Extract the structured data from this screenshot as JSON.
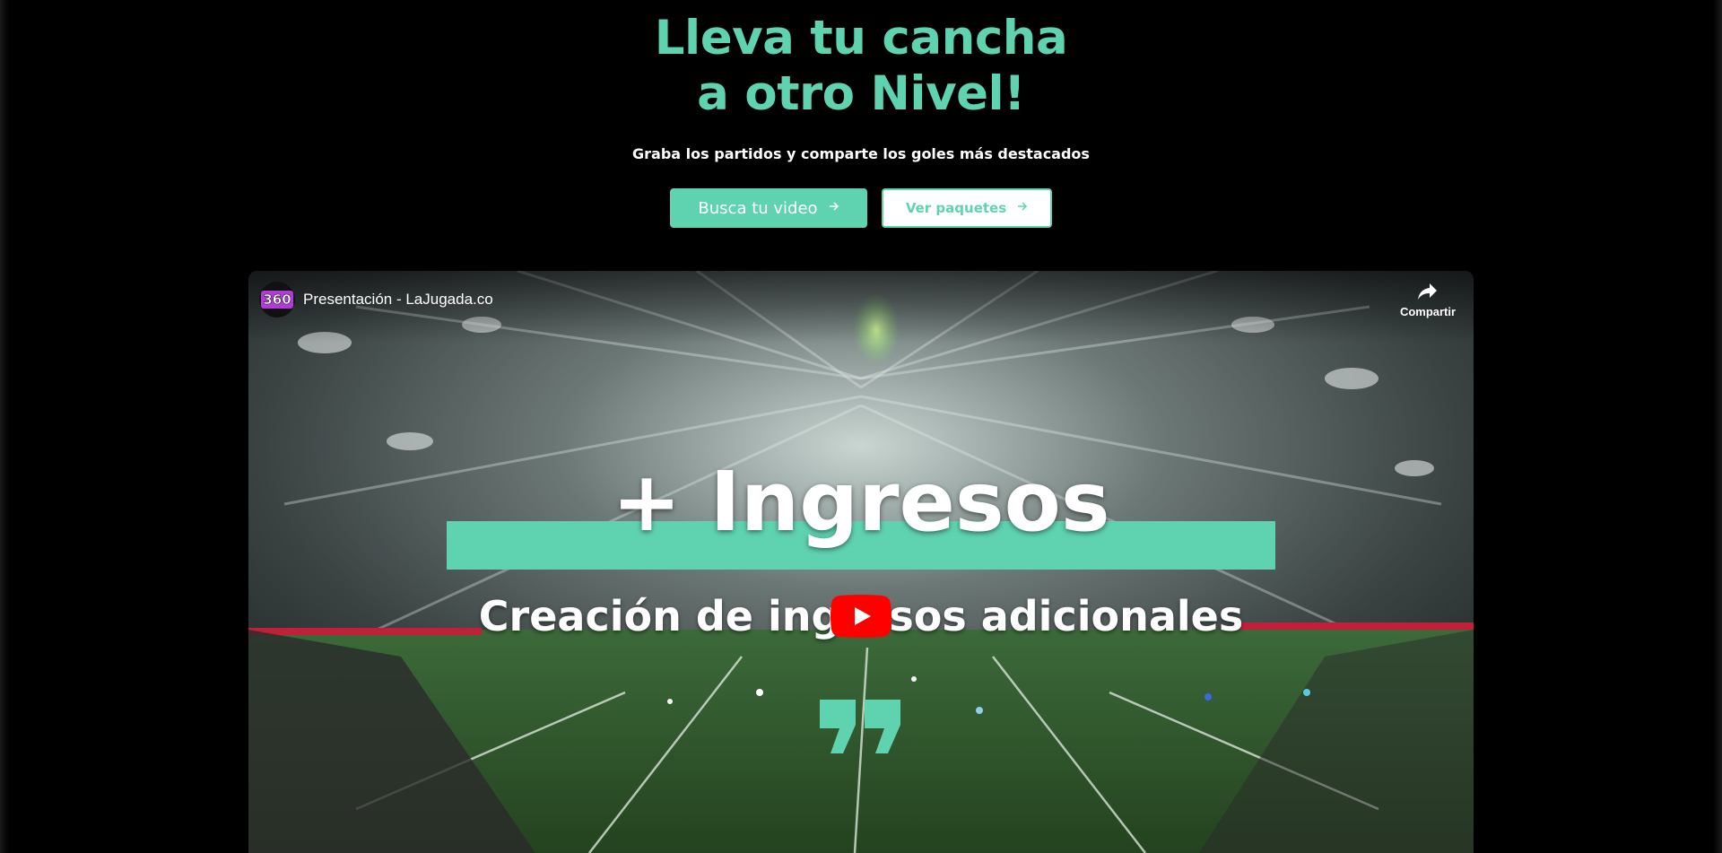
{
  "hero": {
    "title_line1": "Lleva tu cancha",
    "title_line2": "a otro Nivel!",
    "subtitle": "Graba los partidos y comparte los goles más destacados"
  },
  "buttons": {
    "primary_label": "Busca tu video",
    "secondary_label": "Ver paquetes",
    "arrow_icon": "arrow-right-icon"
  },
  "video": {
    "channel_avatar_text": "360",
    "title": "Presentación - LaJugada.co",
    "share_label": "Compartir",
    "overlay_heading": "+ Ingresos",
    "overlay_subheading": "Creación de ingresos adicionales",
    "play_icon": "youtube-play-icon"
  },
  "colors": {
    "accent": "#5fd3b0",
    "background": "#000000",
    "play_red": "#ff0000"
  }
}
